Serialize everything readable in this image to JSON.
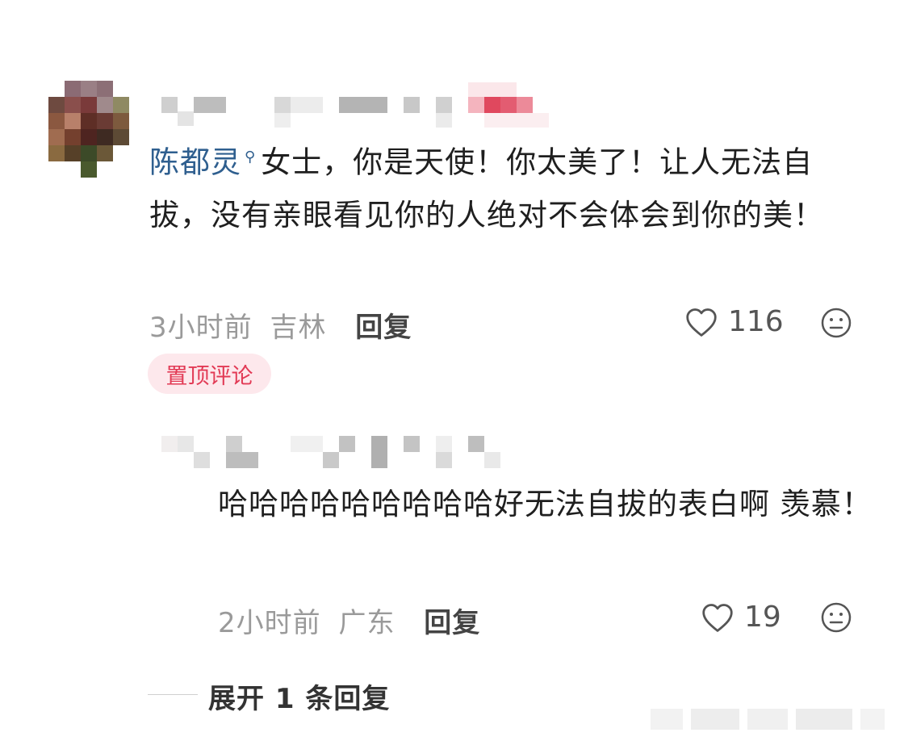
{
  "top_comment": {
    "mention": "陈都灵",
    "text_after_mention": "女士，你是天使！你太美了！让人无法自拔，没有亲眼看见你的人绝对不会体会到你的美！",
    "time": "3小时前",
    "location": "吉林",
    "reply_label": "回复",
    "likes": "116",
    "pinned_label": "置顶评论"
  },
  "reply_comment": {
    "text": "哈哈哈哈哈哈哈哈哈好无法自拔的表白啊 羡慕！",
    "time": "2小时前",
    "location": "广东",
    "reply_label": "回复",
    "likes": "19"
  },
  "expand_label": "展开 1 条回复",
  "icons": {
    "mention": "user-mention-icon",
    "like": "heart-outline-icon",
    "emoji": "neutral-face-icon"
  },
  "colors": {
    "mention": "#2f5f8f",
    "pin_badge_bg": "#fde8ec",
    "pin_badge_text": "#e23a55",
    "meta": "#9a9a9a"
  }
}
